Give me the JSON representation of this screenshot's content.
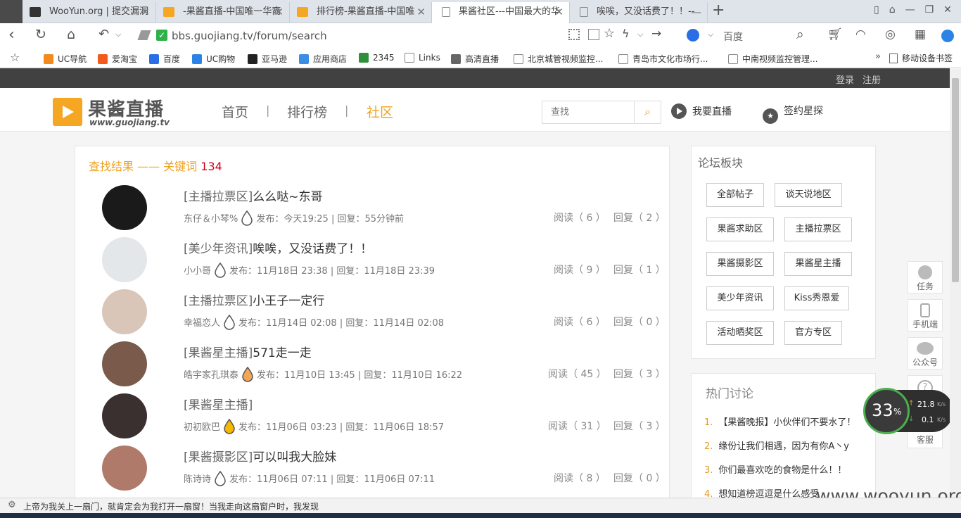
{
  "browser": {
    "tabs": [
      {
        "title": "WooYun.org | 提交漏洞",
        "icon": "wooyun-icon",
        "icon_color": "#333333"
      },
      {
        "title": "-果酱直播-中国唯一华裔",
        "icon": "guojiang-icon",
        "icon_color": "#f5a623"
      },
      {
        "title": "排行榜-果酱直播-中国唯",
        "icon": "guojiang-icon",
        "icon_color": "#f5a623"
      },
      {
        "title": "果酱社区---中国最大的华",
        "icon": "page-icon",
        "icon_color": "#ffffff"
      },
      {
        "title": "唉唉，又没话费了！！--",
        "icon": "page-icon",
        "icon_color": "#ffffff"
      }
    ],
    "url": "bbs.guojiang.tv/forum/search",
    "search_engine": "百度",
    "bookmarks": [
      {
        "label": "UC导航",
        "color": "#f28a1e"
      },
      {
        "label": "爱淘宝",
        "color": "#f35b1a"
      },
      {
        "label": "百度",
        "color": "#2b6de5"
      },
      {
        "label": "UC购物",
        "color": "#2b84e5"
      },
      {
        "label": "亚马逊",
        "color": "#222222"
      },
      {
        "label": "应用商店",
        "color": "#3a8ee6"
      },
      {
        "label": "2345",
        "color": "#2f8f3b"
      },
      {
        "label": "Links",
        "color": "#ffffff"
      },
      {
        "label": "高清直播",
        "color": "#666666"
      },
      {
        "label": "北京城管视频监控...",
        "color": "#ffffff"
      },
      {
        "label": "青岛市文化市场行...",
        "color": "#ffffff"
      },
      {
        "label": "中南视频监控管理...",
        "color": "#ffffff"
      }
    ],
    "mobile_bookmarks": "移动设备书签",
    "more_bookmarks": "»"
  },
  "site": {
    "login": "登录",
    "register": "注册",
    "logo_text": "果酱直播",
    "logo_url": "www.guojiang.tv",
    "nav": [
      "首页",
      "排行榜",
      "社区"
    ],
    "nav_sep": "|",
    "search_placeholder": "查找",
    "live_label": "我要直播",
    "star_label": "签约星探"
  },
  "results": {
    "heading": "查找结果 —— 关键词",
    "keyword": "134",
    "posts": [
      {
        "category": "[主播拉票区]",
        "title": "么么哒~东哥",
        "author": "东仔＆小琴%",
        "meta": "发布：今天19:25 | 回复：55分钟前",
        "reads": "阅读（ 6 ）",
        "replies": "回复（ 2 ）",
        "avatar_color": "#1a1a1a"
      },
      {
        "category": "[美少年资讯]",
        "title": "唉唉，又没话费了！！",
        "author": "小小哥",
        "meta": "发布：11月18日 23:38 | 回复：11月18日 23:39",
        "reads": "阅读（ 9 ）",
        "replies": "回复（ 1 ）",
        "avatar_color": "#e4e7ea"
      },
      {
        "category": "[主播拉票区]",
        "title": "小王子一定行",
        "author": "幸福恋人",
        "meta": "发布：11月14日 02:08 | 回复：11月14日 02:08",
        "reads": "阅读（ 6 ）",
        "replies": "回复（ 0 ）",
        "avatar_color": "#d9c6b8"
      },
      {
        "category": "[果酱星主播]",
        "title": "571走一走",
        "author": "皓宇家孔琪泰",
        "meta": "发布：11月10日 13:45 | 回复：11月10日 16:22",
        "reads": "阅读（ 45 ）",
        "replies": "回复（ 3 ）",
        "avatar_color": "#7a5a4a"
      },
      {
        "category": "[果酱星主播]",
        "title": "",
        "author": "初初欧巴",
        "meta": "发布：11月06日 03:23 | 回复：11月06日 18:57",
        "reads": "阅读（ 31 ）",
        "replies": "回复（ 3 ）",
        "avatar_color": "#3a3030"
      },
      {
        "category": "[果酱摄影区]",
        "title": "可以叫我大脸妹",
        "author": "陈诗诗",
        "meta": "发布：11月06日 07:11 | 回复：11月06日 07:11",
        "reads": "阅读（ 8 ）",
        "replies": "回复（ 0 ）",
        "avatar_color": "#b07a6a"
      }
    ]
  },
  "forum_sections": {
    "title": "论坛板块",
    "items": [
      "全部帖子",
      "谈天说地区",
      "果酱求助区",
      "主播拉票区",
      "果酱摄影区",
      "果酱星主播",
      "美少年资讯",
      "Kiss秀恩爱",
      "活动晒奖区",
      "官方专区"
    ]
  },
  "hot": {
    "title": "热门讨论",
    "items": [
      {
        "n": "1.",
        "text": "【果酱晚报】小伙伴们不要水了！"
      },
      {
        "n": "2.",
        "text": "缘份让我们相遇，因为有你A丶y"
      },
      {
        "n": "3.",
        "text": "你们最喜欢吃的食物是什么！！"
      },
      {
        "n": "4.",
        "text": "想知道榜逗逗是什么感受"
      }
    ]
  },
  "float": [
    "任务",
    "手机端",
    "公众号",
    "客服"
  ],
  "speed": {
    "percent": "33",
    "unit": "%",
    "up": "21.8",
    "down": "0.1",
    "rate_unit": "K/s"
  },
  "status_text": "上帝为我关上一扇门，就肯定会为我打开一扇窗！当我走向这扇窗户时，我发现",
  "watermark": "www.wooyun.org",
  "colors": {
    "accent": "#f0a21b",
    "keyword": "#d0021b",
    "dark": "#414141"
  }
}
